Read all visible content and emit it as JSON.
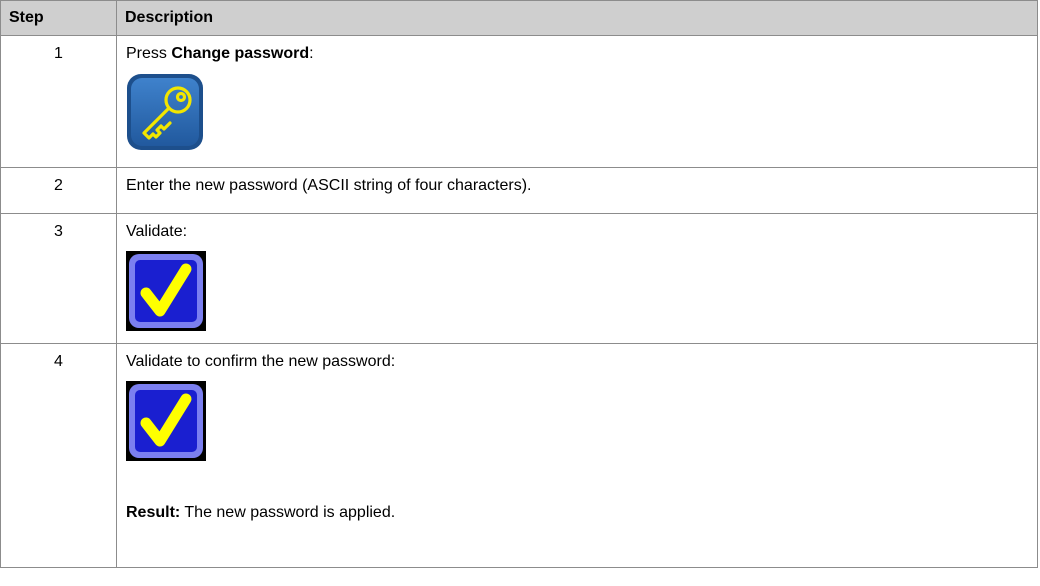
{
  "table": {
    "headers": {
      "step": "Step",
      "description": "Description"
    },
    "rows": [
      {
        "step": "1",
        "text_before": "Press ",
        "text_bold": "Change password",
        "text_after": ":",
        "icon": "key-icon"
      },
      {
        "step": "2",
        "text": "Enter the new password (ASCII string of four characters)."
      },
      {
        "step": "3",
        "text": "Validate:",
        "icon": "checkmark-icon"
      },
      {
        "step": "4",
        "text": "Validate to confirm the new password:",
        "icon": "checkmark-icon",
        "result_label": "Result:",
        "result_text": " The new password is applied."
      }
    ]
  },
  "colors": {
    "header_bg": "#cfcfcf",
    "key_icon_bg": "#2e6fb8",
    "key_icon_stroke": "#f2e600",
    "check_icon_bg": "#1a1fd0",
    "check_icon_mark": "#ffff00"
  }
}
